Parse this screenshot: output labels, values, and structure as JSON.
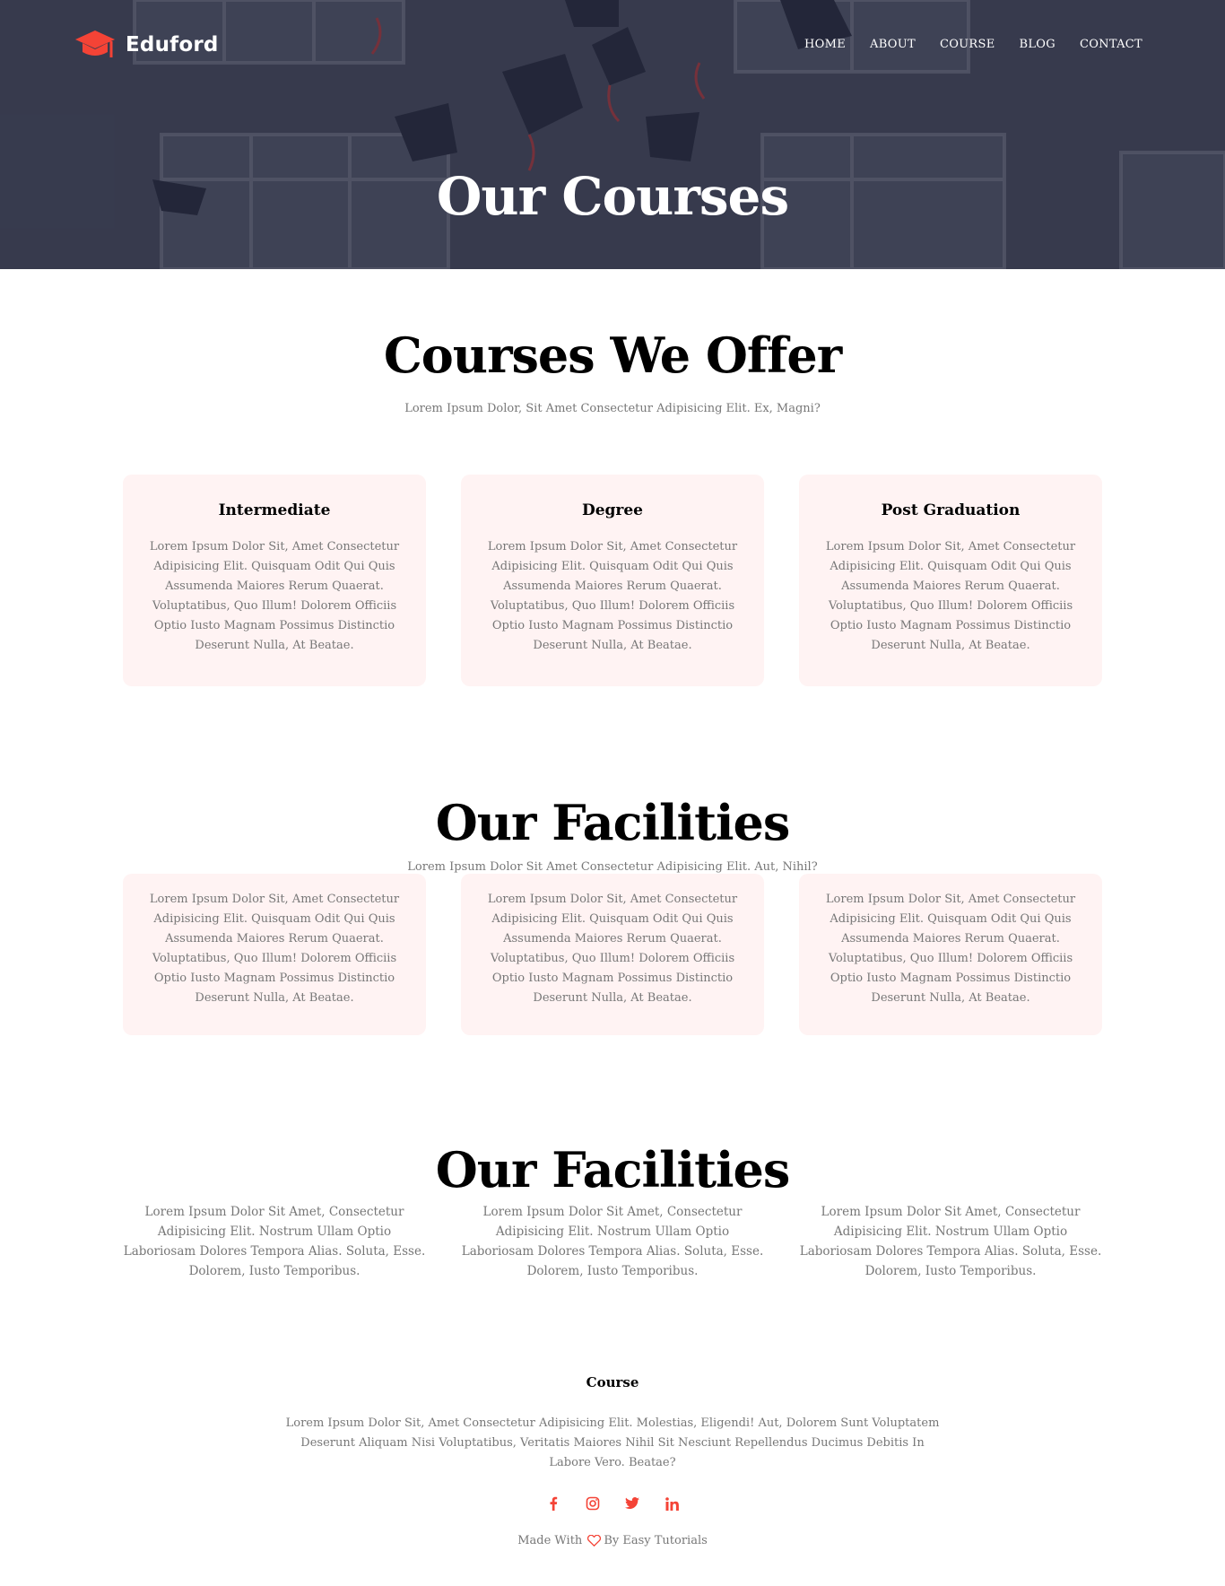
{
  "brand": {
    "name": "Eduford",
    "accent": "#f44336"
  },
  "nav": {
    "items": [
      "HOME",
      "ABOUT",
      "COURSE",
      "BLOG",
      "CONTACT"
    ]
  },
  "hero": {
    "title": "Our Courses"
  },
  "courses": {
    "title": "Courses We Offer",
    "subtitle": "Lorem Ipsum Dolor, Sit Amet Consectetur Adipisicing Elit. Ex, Magni?",
    "cards": [
      {
        "title": "Intermediate",
        "text": "Lorem Ipsum Dolor Sit, Amet Consectetur Adipisicing Elit. Quisquam Odit Qui Quis Assumenda Maiores Rerum Quaerat. Voluptatibus, Quo Illum! Dolorem Officiis Optio Iusto Magnam Possimus Distinctio Deserunt Nulla, At Beatae."
      },
      {
        "title": "Degree",
        "text": "Lorem Ipsum Dolor Sit, Amet Consectetur Adipisicing Elit. Quisquam Odit Qui Quis Assumenda Maiores Rerum Quaerat. Voluptatibus, Quo Illum! Dolorem Officiis Optio Iusto Magnam Possimus Distinctio Deserunt Nulla, At Beatae."
      },
      {
        "title": "Post Graduation",
        "text": "Lorem Ipsum Dolor Sit, Amet Consectetur Adipisicing Elit. Quisquam Odit Qui Quis Assumenda Maiores Rerum Quaerat. Voluptatibus, Quo Illum! Dolorem Officiis Optio Iusto Magnam Possimus Distinctio Deserunt Nulla, At Beatae."
      }
    ]
  },
  "facilities": {
    "title": "Our Facilities",
    "subtitle": "Lorem Ipsum Dolor Sit Amet Consectetur Adipisicing Elit. Aut, Nihil?",
    "cards": [
      {
        "text": "Lorem Ipsum Dolor Sit, Amet Consectetur Adipisicing Elit. Quisquam Odit Qui Quis Assumenda Maiores Rerum Quaerat. Voluptatibus, Quo Illum! Dolorem Officiis Optio Iusto Magnam Possimus Distinctio Deserunt Nulla, At Beatae."
      },
      {
        "text": "Lorem Ipsum Dolor Sit, Amet Consectetur Adipisicing Elit. Quisquam Odit Qui Quis Assumenda Maiores Rerum Quaerat. Voluptatibus, Quo Illum! Dolorem Officiis Optio Iusto Magnam Possimus Distinctio Deserunt Nulla, At Beatae."
      },
      {
        "text": "Lorem Ipsum Dolor Sit, Amet Consectetur Adipisicing Elit. Quisquam Odit Qui Quis Assumenda Maiores Rerum Quaerat. Voluptatibus, Quo Illum! Dolorem Officiis Optio Iusto Magnam Possimus Distinctio Deserunt Nulla, At Beatae."
      }
    ]
  },
  "facilities2": {
    "title": "Our Facilities",
    "cols": [
      "Lorem Ipsum Dolor Sit Amet, Consectetur Adipisicing Elit. Nostrum Ullam Optio Laboriosam Dolores Tempora Alias. Soluta, Esse. Dolorem, Iusto Temporibus.",
      "Lorem Ipsum Dolor Sit Amet, Consectetur Adipisicing Elit. Nostrum Ullam Optio Laboriosam Dolores Tempora Alias. Soluta, Esse. Dolorem, Iusto Temporibus.",
      "Lorem Ipsum Dolor Sit Amet, Consectetur Adipisicing Elit. Nostrum Ullam Optio Laboriosam Dolores Tempora Alias. Soluta, Esse. Dolorem, Iusto Temporibus."
    ]
  },
  "footer": {
    "title": "Course",
    "text": "Lorem Ipsum Dolor Sit, Amet Consectetur Adipisicing Elit. Molestias, Eligendi! Aut, Dolorem Sunt Voluptatem Deserunt Aliquam Nisi Voluptatibus, Veritatis Maiores Nihil Sit Nesciunt Repellendus Ducimus Debitis In Labore Vero. Beatae?",
    "socials": [
      "facebook-icon",
      "instagram-icon",
      "twitter-icon",
      "linkedin-icon"
    ],
    "credit_prefix": "Made With",
    "credit_suffix": "By Easy Tutorials"
  }
}
